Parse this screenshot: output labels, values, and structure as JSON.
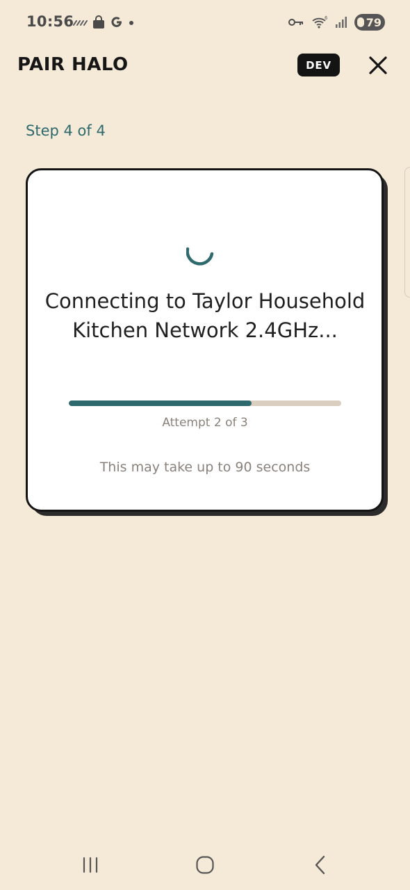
{
  "status_bar": {
    "time": "10:56",
    "battery": "79",
    "left_icons": [
      "signal-dashes-icon",
      "shopping-bag-icon",
      "google-g-icon",
      "dot-icon"
    ],
    "right_icons": [
      "vpn-key-icon",
      "wifi-icon",
      "cell-signal-icon",
      "battery-icon"
    ]
  },
  "header": {
    "title": "PAIR HALO",
    "badge": "DEV",
    "close_icon": "close-icon"
  },
  "step": "Step 4 of 4",
  "card": {
    "title": "Connecting to Taylor Household Kitchen Network 2.4GHz...",
    "progress": 0.67,
    "attempt": "Attempt 2 of 3",
    "note": "This may take up to 90 seconds"
  },
  "colors": {
    "background": "#f5e9d8",
    "accent": "#2e6a6d",
    "track": "#d9cebf",
    "muted_text": "#8a817a"
  },
  "nav_bar": {
    "icons": [
      "recent-apps-icon",
      "home-icon",
      "back-icon"
    ]
  }
}
